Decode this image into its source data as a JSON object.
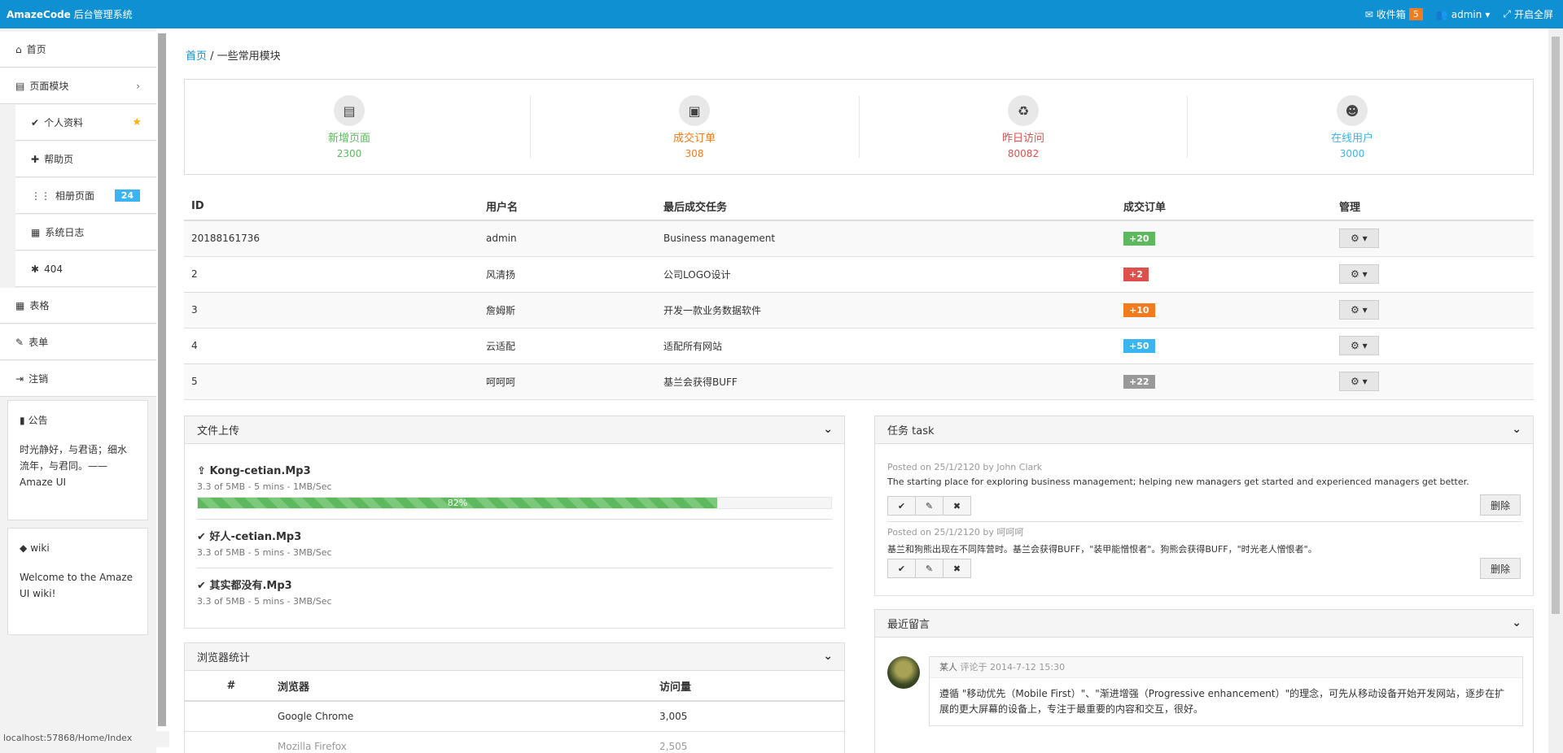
{
  "topbar": {
    "brand_bold": "AmazeCode",
    "brand_rest": " 后台管理系统",
    "inbox_label": "收件箱",
    "inbox_count": "5",
    "user_label": "admin",
    "fullscreen_label": "开启全屏"
  },
  "sidebar": {
    "home": "首页",
    "pages": "页面模块",
    "sub": {
      "profile": "个人资料",
      "help": "帮助页",
      "gallery": "相册页面",
      "gallery_count": "24",
      "log": "系统日志",
      "notfound": "404"
    },
    "table": "表格",
    "form": "表单",
    "logout": "注销",
    "notice_title": "公告",
    "notice_body": "时光静好，与君语；细水流年，与君同。—— Amaze UI",
    "wiki_title": "wiki",
    "wiki_body": "Welcome to the Amaze UI wiki!"
  },
  "status_url": "localhost:57868/Home/Index",
  "breadcrumb": {
    "home": "首页",
    "current": "一些常用模块"
  },
  "stats": [
    {
      "label": "新增页面",
      "value": "2300",
      "color": "#5eb95e",
      "icon": "file-icon"
    },
    {
      "label": "成交订单",
      "value": "308",
      "color": "#f37b1d",
      "icon": "briefcase-icon"
    },
    {
      "label": "昨日访问",
      "value": "80082",
      "color": "#dd514c",
      "icon": "recycle-icon"
    },
    {
      "label": "在线用户",
      "value": "3000",
      "color": "#3bb4f2",
      "icon": "user-icon"
    }
  ],
  "table": {
    "headers": [
      "ID",
      "用户名",
      "最后成交任务",
      "成交订单",
      "管理"
    ],
    "rows": [
      {
        "id": "20188161736",
        "user": "admin",
        "task": "Business management",
        "orders": "+20",
        "color": "#5eb95e"
      },
      {
        "id": "2",
        "user": "风清扬",
        "task": "公司LOGO设计",
        "orders": "+2",
        "color": "#dd514c"
      },
      {
        "id": "3",
        "user": "詹姆斯",
        "task": "开发一款业务数据软件",
        "orders": "+10",
        "color": "#f37b1d"
      },
      {
        "id": "4",
        "user": "云适配",
        "task": "适配所有网站",
        "orders": "+50",
        "color": "#3bb4f2"
      },
      {
        "id": "5",
        "user": "呵呵呵",
        "task": "基兰会获得BUFF",
        "orders": "+22",
        "color": "#999999"
      }
    ]
  },
  "upload": {
    "title": "文件上传",
    "files": [
      {
        "name": "Kong-cetian.Mp3",
        "meta": "3.3 of 5MB - 5 mins - 1MB/Sec",
        "progress_pct": 82,
        "progress_label": "82%"
      },
      {
        "name": "好人-cetian.Mp3",
        "meta": "3.3 of 5MB - 5 mins - 3MB/Sec"
      },
      {
        "name": "其实都没有.Mp3",
        "meta": "3.3 of 5MB - 5 mins - 3MB/Sec"
      }
    ]
  },
  "browsers": {
    "title": "浏览器统计",
    "headers": [
      "#",
      "浏览器",
      "访问量"
    ],
    "rows": [
      {
        "name": "Google Chrome",
        "visits": "3,005"
      },
      {
        "name": "Mozilla Firefox",
        "visits": "2,505"
      }
    ]
  },
  "tasks": {
    "title": "任务 task",
    "items": [
      {
        "posted": "Posted on 25/1/2120 by John Clark",
        "text": "The starting place for exploring business management; helping new managers get started and experienced managers get better.",
        "delete": "删除"
      },
      {
        "posted": "Posted on 25/1/2120 by 呵呵呵",
        "text": "基兰和狗熊出现在不同阵营时。基兰会获得BUFF，\"装甲能憎恨者\"。狗熊会获得BUFF，\"时光老人憎恨者\"。",
        "delete": "删除"
      }
    ]
  },
  "comments": {
    "title": "最近留言",
    "author": "某人",
    "meta": "评论于 2014-7-12 15:30",
    "body": "遵循 \"移动优先（Mobile First）\"、\"渐进增强（Progressive enhancement）\"的理念，可先从移动设备开始开发网站，逐步在扩展的更大屏幕的设备上，专注于最重要的内容和交互，很好。"
  }
}
